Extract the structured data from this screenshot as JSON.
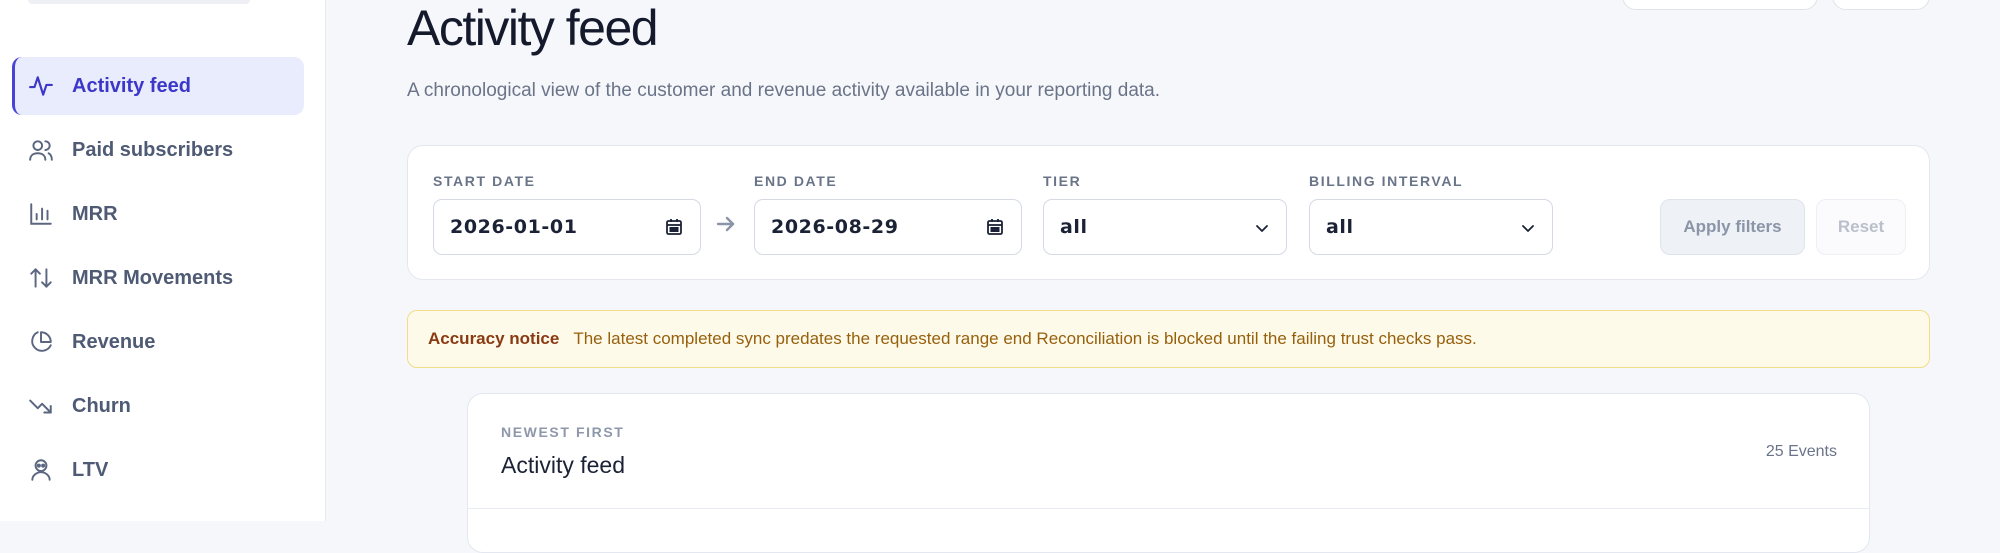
{
  "sidebar": {
    "items": [
      {
        "label": "Activity feed",
        "icon": "activity-icon",
        "active": true
      },
      {
        "label": "Paid subscribers",
        "icon": "users-icon"
      },
      {
        "label": "MRR",
        "icon": "bar-chart-icon"
      },
      {
        "label": "MRR Movements",
        "icon": "arrows-up-down-icon"
      },
      {
        "label": "Revenue",
        "icon": "pie-chart-icon"
      },
      {
        "label": "Churn",
        "icon": "trending-down-icon"
      },
      {
        "label": "LTV",
        "icon": "user-badge-icon"
      }
    ]
  },
  "header": {
    "title": "Activity feed",
    "subtitle": "A chronological view of the customer and revenue activity available in your reporting data."
  },
  "filters": {
    "start_date": {
      "label": "START DATE",
      "value": "2026-01-01"
    },
    "end_date": {
      "label": "END DATE",
      "value": "2026-08-29"
    },
    "tier": {
      "label": "TIER",
      "value": "all"
    },
    "billing_interval": {
      "label": "BILLING INTERVAL",
      "value": "all"
    },
    "apply_label": "Apply filters",
    "reset_label": "Reset"
  },
  "notice": {
    "title": "Accuracy notice",
    "text": "The latest completed sync predates the requested range end Reconciliation is blocked until the failing trust checks pass."
  },
  "feed": {
    "eyebrow": "NEWEST FIRST",
    "title": "Activity feed",
    "count": "25 Events"
  },
  "colors": {
    "accent": "#4a44d6",
    "notice_bg": "#fefaea",
    "notice_text": "#97600d"
  }
}
